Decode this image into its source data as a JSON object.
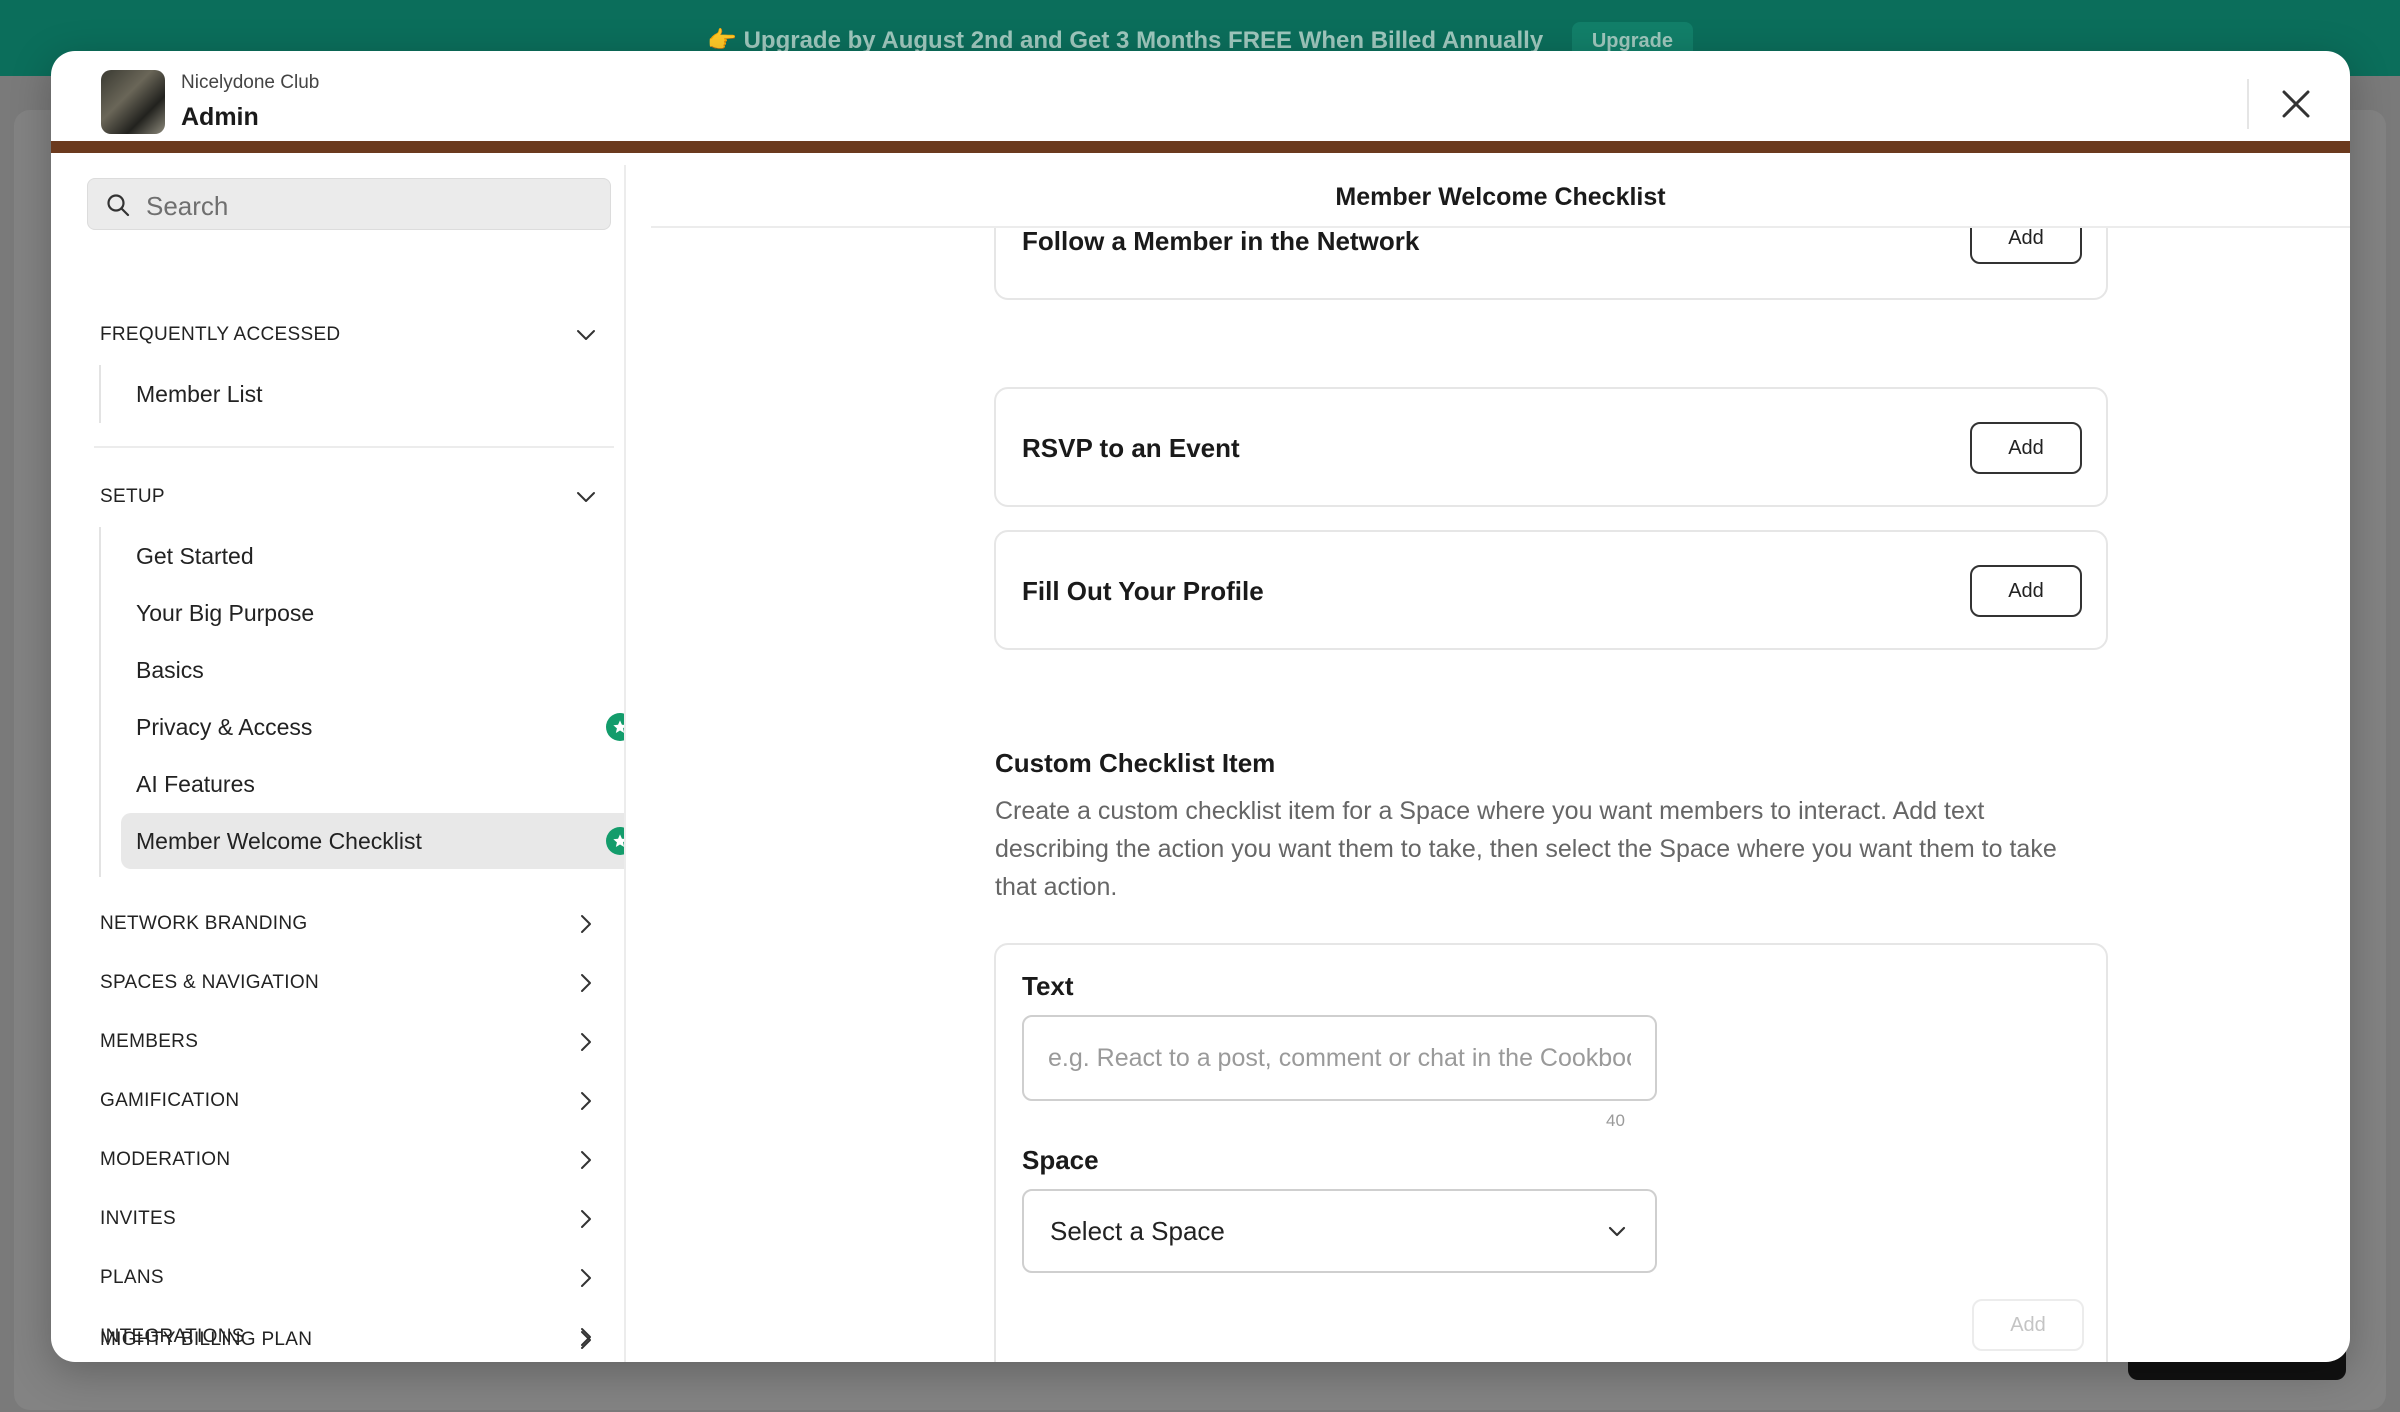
{
  "banner": {
    "icon": "pointing-hand-icon",
    "text": "Upgrade by August 2nd and Get 3 Months FREE When Billed Annually",
    "button_label": "Upgrade"
  },
  "modal": {
    "club_name": "Nicelydone Club",
    "title": "Admin",
    "accent_color": "#6b3a1e"
  },
  "sidebar": {
    "search_placeholder": "Search",
    "frequently_accessed": {
      "label": "FREQUENTLY ACCESSED",
      "items": [
        {
          "label": "Member List"
        }
      ]
    },
    "setup": {
      "label": "SETUP",
      "items": [
        {
          "label": "Get Started"
        },
        {
          "label": "Your Big Purpose"
        },
        {
          "label": "Basics"
        },
        {
          "label": "Privacy & Access",
          "badge": "star-badge-icon"
        },
        {
          "label": "AI Features"
        },
        {
          "label": "Member Welcome Checklist",
          "badge": "star-badge-icon",
          "active": true
        }
      ]
    },
    "sections": [
      {
        "label": "NETWORK BRANDING"
      },
      {
        "label": "SPACES & NAVIGATION"
      },
      {
        "label": "MEMBERS"
      },
      {
        "label": "GAMIFICATION"
      },
      {
        "label": "MODERATION"
      },
      {
        "label": "INVITES"
      },
      {
        "label": "PLANS"
      },
      {
        "label": "INTEGRATIONS"
      },
      {
        "label": "MIGHTY BILLING PLAN"
      }
    ]
  },
  "content": {
    "title": "Member Welcome Checklist",
    "tasks": [
      {
        "label": "Follow a Member in the Network",
        "button": "Add"
      },
      {
        "label": "RSVP to an Event",
        "button": "Add"
      },
      {
        "label": "Fill Out Your Profile",
        "button": "Add"
      }
    ],
    "custom": {
      "title": "Custom Checklist Item",
      "description": "Create a custom checklist item for a Space where you want members to interact. Add text describing the action you want them to take, then select the Space where you want them to take that action.",
      "text_label": "Text",
      "text_placeholder": "e.g. React to a post, comment or chat in the Cookbook",
      "char_count": "40",
      "space_label": "Space",
      "space_value": "Select a Space",
      "add_button": "Add"
    }
  },
  "colors": {
    "banner": "#0b6e5b",
    "badge": "#139c6b",
    "header_stripe": "#6b3a1e"
  }
}
